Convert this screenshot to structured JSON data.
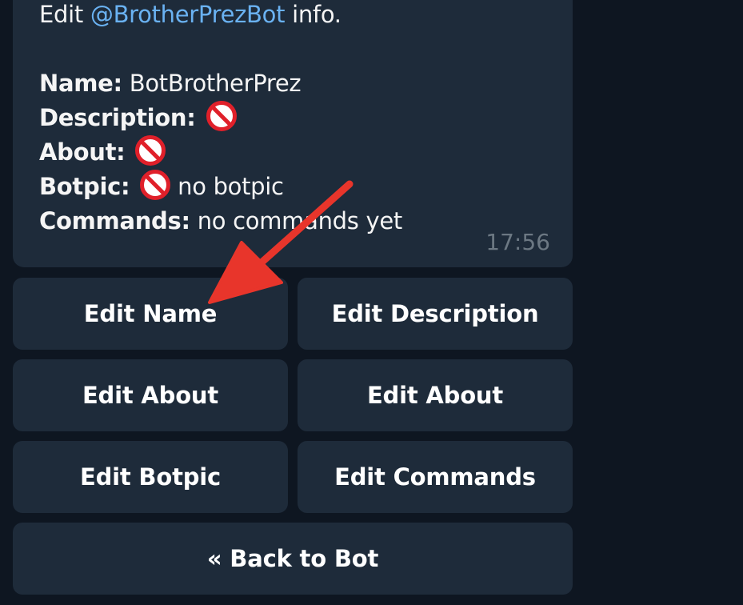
{
  "message": {
    "intro_prefix": "Edit ",
    "mention": "@BrotherPrezBot",
    "intro_suffix": " info.",
    "fields": {
      "name_label": "Name:",
      "name_value": "BotBrotherPrez",
      "description_label": "Description:",
      "about_label": "About:",
      "botpic_label": "Botpic:",
      "botpic_value": "no botpic",
      "commands_label": "Commands:",
      "commands_value": "no commands yet"
    },
    "time": "17:56"
  },
  "keyboard": {
    "edit_name": "Edit Name",
    "edit_description": "Edit Description",
    "edit_about_left": "Edit About",
    "edit_about_right": "Edit About",
    "edit_botpic": "Edit Botpic",
    "edit_commands": "Edit Commands",
    "back_to_bot": "« Back to Bot"
  },
  "icons": {
    "no_entry": "no-entry-icon",
    "annotation": "red-arrow-icon"
  },
  "colors": {
    "background": "#0e1621",
    "bubble": "#1e2b3a",
    "mention": "#6ab2f2",
    "arrow": "#e8352b",
    "timestamp": "#6c7883"
  }
}
